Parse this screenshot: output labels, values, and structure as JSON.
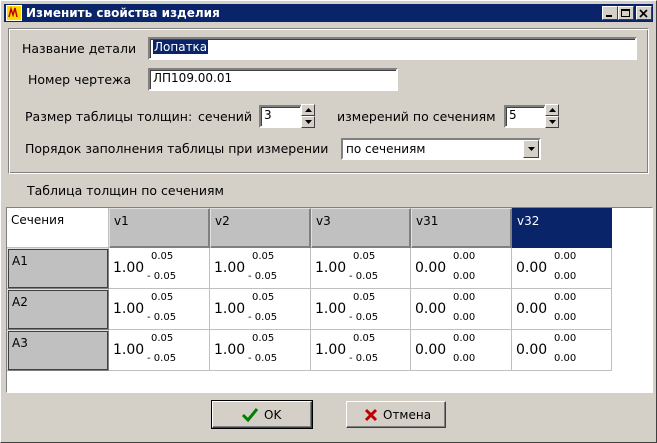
{
  "window": {
    "title": "Изменить свойства изделия"
  },
  "form": {
    "part_name_label": "Название детали",
    "part_name_value": "Лопатка",
    "drawing_number_label": "Номер чертежа",
    "drawing_number_value": "ЛП109.00.01",
    "table_size_label": "Размер таблицы толщин:",
    "sections_label": "сечений",
    "sections_value": "3",
    "measurements_label": "измерений по сечениям",
    "measurements_value": "5",
    "fill_order_label": "Порядок заполнения таблицы при измерении",
    "fill_order_value": "по сечениям"
  },
  "table": {
    "caption": "Таблица толщин по сечениям",
    "corner": "Сечения",
    "columns": [
      "v1",
      "v2",
      "v3",
      "v31",
      "v32"
    ],
    "rows": [
      {
        "label": "A1",
        "cells": [
          {
            "value": "1.00",
            "upper": "0.05",
            "lower": "- 0.05"
          },
          {
            "value": "1.00",
            "upper": "0.05",
            "lower": "- 0.05"
          },
          {
            "value": "1.00",
            "upper": "0.05",
            "lower": "- 0.05"
          },
          {
            "value": "0.00",
            "upper": "0.00",
            "lower": "0.00"
          },
          {
            "value": "0.00",
            "upper": "0.00",
            "lower": "0.00"
          }
        ]
      },
      {
        "label": "A2",
        "cells": [
          {
            "value": "1.00",
            "upper": "0.05",
            "lower": "- 0.05"
          },
          {
            "value": "1.00",
            "upper": "0.05",
            "lower": "- 0.05"
          },
          {
            "value": "1.00",
            "upper": "0.05",
            "lower": "- 0.05"
          },
          {
            "value": "0.00",
            "upper": "0.00",
            "lower": "0.00"
          },
          {
            "value": "0.00",
            "upper": "0.00",
            "lower": "0.00"
          }
        ]
      },
      {
        "label": "A3",
        "cells": [
          {
            "value": "1.00",
            "upper": "0.05",
            "lower": "- 0.05"
          },
          {
            "value": "1.00",
            "upper": "0.05",
            "lower": "- 0.05"
          },
          {
            "value": "1.00",
            "upper": "0.05",
            "lower": "- 0.05"
          },
          {
            "value": "0.00",
            "upper": "0.00",
            "lower": "0.00"
          },
          {
            "value": "0.00",
            "upper": "0.00",
            "lower": "0.00"
          }
        ]
      }
    ]
  },
  "buttons": {
    "ok_label": "OK",
    "cancel_label": "Отмена"
  },
  "icons": {
    "app": "app-icon",
    "ok": "checkmark-icon",
    "cancel": "cross-icon"
  }
}
